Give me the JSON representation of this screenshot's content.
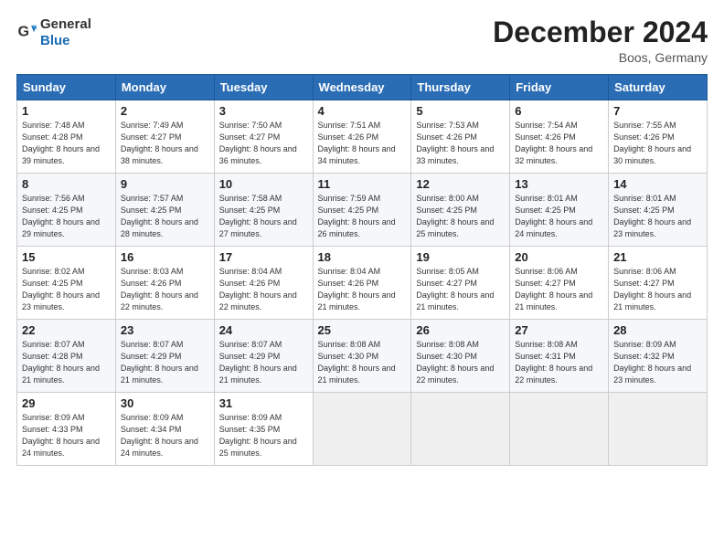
{
  "logo": {
    "general": "General",
    "blue": "Blue"
  },
  "title": "December 2024",
  "location": "Boos, Germany",
  "days_header": [
    "Sunday",
    "Monday",
    "Tuesday",
    "Wednesday",
    "Thursday",
    "Friday",
    "Saturday"
  ],
  "weeks": [
    [
      {
        "day": "1",
        "sunrise": "7:48 AM",
        "sunset": "4:28 PM",
        "daylight": "8 hours and 39 minutes."
      },
      {
        "day": "2",
        "sunrise": "7:49 AM",
        "sunset": "4:27 PM",
        "daylight": "8 hours and 38 minutes."
      },
      {
        "day": "3",
        "sunrise": "7:50 AM",
        "sunset": "4:27 PM",
        "daylight": "8 hours and 36 minutes."
      },
      {
        "day": "4",
        "sunrise": "7:51 AM",
        "sunset": "4:26 PM",
        "daylight": "8 hours and 34 minutes."
      },
      {
        "day": "5",
        "sunrise": "7:53 AM",
        "sunset": "4:26 PM",
        "daylight": "8 hours and 33 minutes."
      },
      {
        "day": "6",
        "sunrise": "7:54 AM",
        "sunset": "4:26 PM",
        "daylight": "8 hours and 32 minutes."
      },
      {
        "day": "7",
        "sunrise": "7:55 AM",
        "sunset": "4:26 PM",
        "daylight": "8 hours and 30 minutes."
      }
    ],
    [
      {
        "day": "8",
        "sunrise": "7:56 AM",
        "sunset": "4:25 PM",
        "daylight": "8 hours and 29 minutes."
      },
      {
        "day": "9",
        "sunrise": "7:57 AM",
        "sunset": "4:25 PM",
        "daylight": "8 hours and 28 minutes."
      },
      {
        "day": "10",
        "sunrise": "7:58 AM",
        "sunset": "4:25 PM",
        "daylight": "8 hours and 27 minutes."
      },
      {
        "day": "11",
        "sunrise": "7:59 AM",
        "sunset": "4:25 PM",
        "daylight": "8 hours and 26 minutes."
      },
      {
        "day": "12",
        "sunrise": "8:00 AM",
        "sunset": "4:25 PM",
        "daylight": "8 hours and 25 minutes."
      },
      {
        "day": "13",
        "sunrise": "8:01 AM",
        "sunset": "4:25 PM",
        "daylight": "8 hours and 24 minutes."
      },
      {
        "day": "14",
        "sunrise": "8:01 AM",
        "sunset": "4:25 PM",
        "daylight": "8 hours and 23 minutes."
      }
    ],
    [
      {
        "day": "15",
        "sunrise": "8:02 AM",
        "sunset": "4:25 PM",
        "daylight": "8 hours and 23 minutes."
      },
      {
        "day": "16",
        "sunrise": "8:03 AM",
        "sunset": "4:26 PM",
        "daylight": "8 hours and 22 minutes."
      },
      {
        "day": "17",
        "sunrise": "8:04 AM",
        "sunset": "4:26 PM",
        "daylight": "8 hours and 22 minutes."
      },
      {
        "day": "18",
        "sunrise": "8:04 AM",
        "sunset": "4:26 PM",
        "daylight": "8 hours and 21 minutes."
      },
      {
        "day": "19",
        "sunrise": "8:05 AM",
        "sunset": "4:27 PM",
        "daylight": "8 hours and 21 minutes."
      },
      {
        "day": "20",
        "sunrise": "8:06 AM",
        "sunset": "4:27 PM",
        "daylight": "8 hours and 21 minutes."
      },
      {
        "day": "21",
        "sunrise": "8:06 AM",
        "sunset": "4:27 PM",
        "daylight": "8 hours and 21 minutes."
      }
    ],
    [
      {
        "day": "22",
        "sunrise": "8:07 AM",
        "sunset": "4:28 PM",
        "daylight": "8 hours and 21 minutes."
      },
      {
        "day": "23",
        "sunrise": "8:07 AM",
        "sunset": "4:29 PM",
        "daylight": "8 hours and 21 minutes."
      },
      {
        "day": "24",
        "sunrise": "8:07 AM",
        "sunset": "4:29 PM",
        "daylight": "8 hours and 21 minutes."
      },
      {
        "day": "25",
        "sunrise": "8:08 AM",
        "sunset": "4:30 PM",
        "daylight": "8 hours and 21 minutes."
      },
      {
        "day": "26",
        "sunrise": "8:08 AM",
        "sunset": "4:30 PM",
        "daylight": "8 hours and 22 minutes."
      },
      {
        "day": "27",
        "sunrise": "8:08 AM",
        "sunset": "4:31 PM",
        "daylight": "8 hours and 22 minutes."
      },
      {
        "day": "28",
        "sunrise": "8:09 AM",
        "sunset": "4:32 PM",
        "daylight": "8 hours and 23 minutes."
      }
    ],
    [
      {
        "day": "29",
        "sunrise": "8:09 AM",
        "sunset": "4:33 PM",
        "daylight": "8 hours and 24 minutes."
      },
      {
        "day": "30",
        "sunrise": "8:09 AM",
        "sunset": "4:34 PM",
        "daylight": "8 hours and 24 minutes."
      },
      {
        "day": "31",
        "sunrise": "8:09 AM",
        "sunset": "4:35 PM",
        "daylight": "8 hours and 25 minutes."
      },
      null,
      null,
      null,
      null
    ]
  ]
}
